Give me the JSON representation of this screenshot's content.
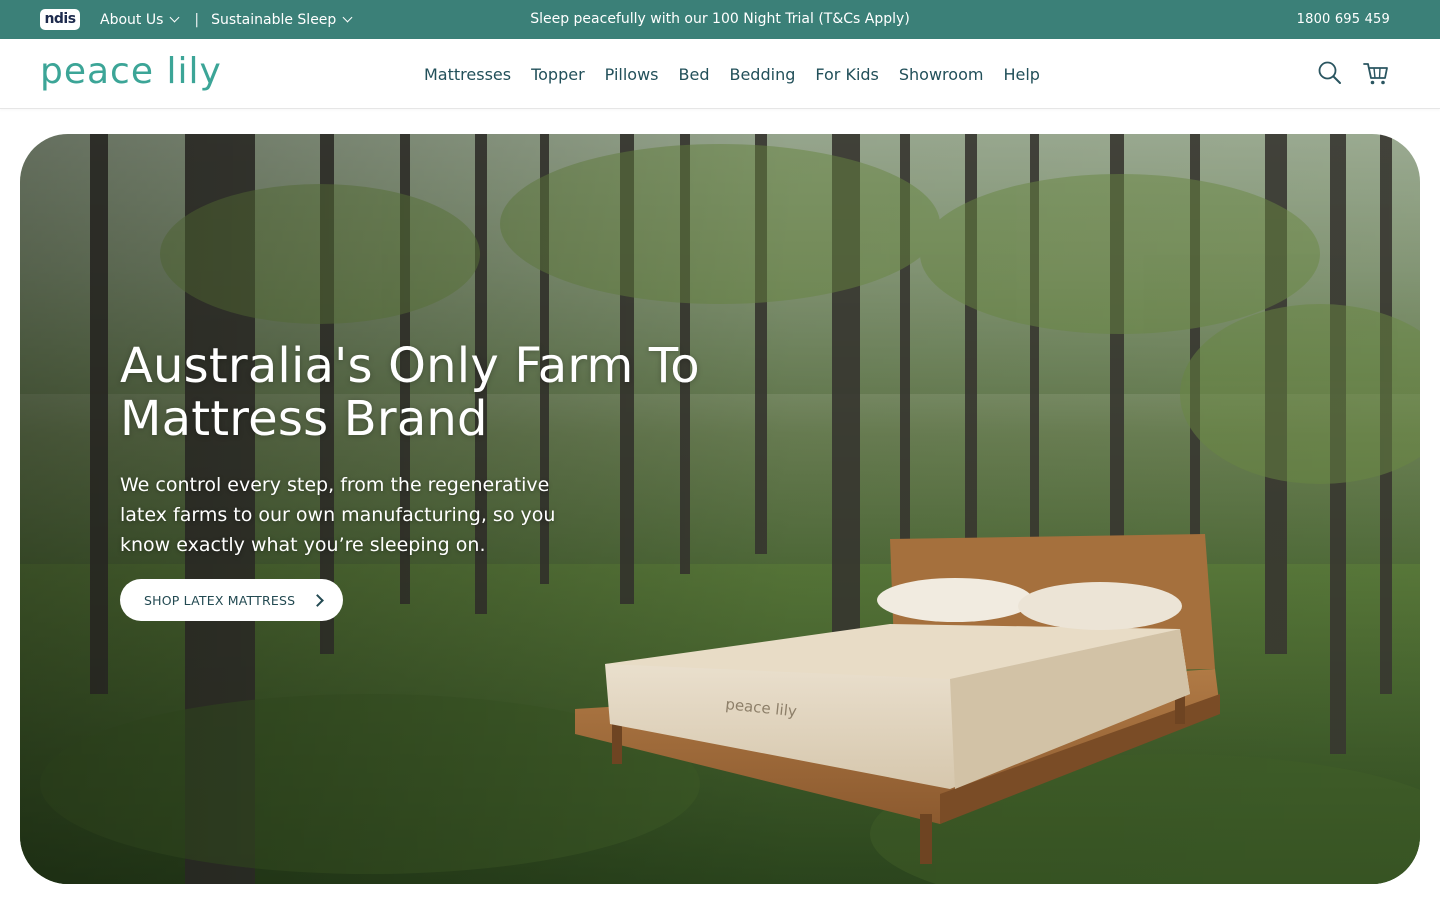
{
  "topbar": {
    "ndis_logo": "ndis",
    "nav": [
      {
        "label": "About Us"
      },
      {
        "label": "Sustainable Sleep"
      }
    ],
    "separator": "|",
    "promo": "Sleep peacefully with our 100 Night Trial (T&Cs Apply)",
    "phone": "1800 695 459"
  },
  "header": {
    "logo_text": "peace lily",
    "nav": [
      {
        "label": "Mattresses"
      },
      {
        "label": "Topper"
      },
      {
        "label": "Pillows"
      },
      {
        "label": "Bed"
      },
      {
        "label": "Bedding"
      },
      {
        "label": "For Kids"
      },
      {
        "label": "Showroom"
      },
      {
        "label": "Help"
      }
    ],
    "icons": [
      "search-icon",
      "cart-icon"
    ]
  },
  "hero": {
    "title": "Australia's Only Farm To Mattress Brand",
    "subtitle": "We control every step, from the regenerative latex farms to our own manufacturing, so you know exactly what you’re sleeping on.",
    "cta_label": "Shop Latex Mattress",
    "mattress_brand_mark": "peace lily"
  },
  "colors": {
    "brand_teal": "#3b8078",
    "text_dark_teal": "#22505a",
    "white": "#ffffff"
  }
}
